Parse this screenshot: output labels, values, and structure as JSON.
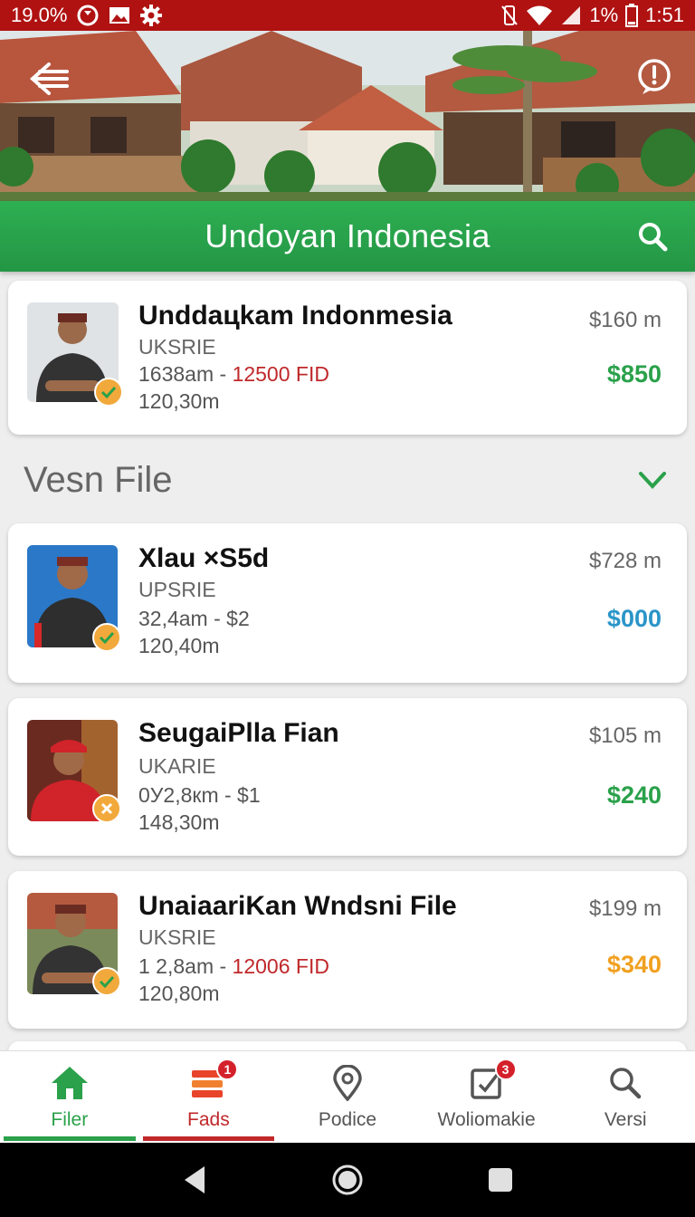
{
  "status_bar": {
    "left_text": "19.0%",
    "battery": "1%",
    "time": "1:51",
    "icons": [
      "data-saver-icon",
      "image-icon",
      "gear-icon",
      "vibrate-icon",
      "wifi-icon",
      "signal-icon",
      "battery-icon"
    ]
  },
  "header": {
    "title": "Undoyan Indonesia",
    "back_icon": "back-arrow-icon",
    "info_icon": "info-icon",
    "search_icon": "search-icon"
  },
  "featured": {
    "title": "Unddaцkam Indonmesia",
    "sub": "UKSRIE",
    "line1_a": "1638am - ",
    "line1_b": "12500 FID",
    "line2": "120,30m",
    "distance": "$160 m",
    "price": "$850",
    "price_color": "#2aa14a"
  },
  "section": {
    "title": "Vesn File",
    "chevron_icon": "chevron-down-icon"
  },
  "items": [
    {
      "title": "Xlau ×S5d",
      "sub": "UPSRIE",
      "line1_a": "32,4am - $2",
      "line1_b": "",
      "line2": "120,40m",
      "distance": "$728 m",
      "price": "$000",
      "price_color": "#2a95c8"
    },
    {
      "title": "SeugaiPlla Fian",
      "sub": "UKARIE",
      "line1_a": "0У2,8кm - $1",
      "line1_b": "",
      "line2": "148,30m",
      "distance": "$105 m",
      "price": "$240",
      "price_color": "#2aa14a"
    },
    {
      "title": "UnaiaariKan Wndsni File",
      "sub": "UKSRIE",
      "line1_a": "1 2,8am - ",
      "line1_b": "12006 FID",
      "line2": "120,80m",
      "distance": "$199 m",
      "price": "$340",
      "price_color": "#f0a020"
    }
  ],
  "bottom_nav": [
    {
      "label": "Filer",
      "icon": "home-icon",
      "color": "#2aa14a",
      "badge": ""
    },
    {
      "label": "Fads",
      "icon": "stack-icon",
      "color": "#c0282a",
      "badge": "1"
    },
    {
      "label": "Podiсe",
      "icon": "location-pin-icon",
      "color": "#555555",
      "badge": ""
    },
    {
      "label": "Woliomakie",
      "icon": "edit-box-icon",
      "color": "#555555",
      "badge": "3"
    },
    {
      "label": "Versi",
      "icon": "search-icon",
      "color": "#555555",
      "badge": ""
    }
  ],
  "system_nav": [
    "back-triangle-icon",
    "home-circle-icon",
    "recents-square-icon"
  ]
}
